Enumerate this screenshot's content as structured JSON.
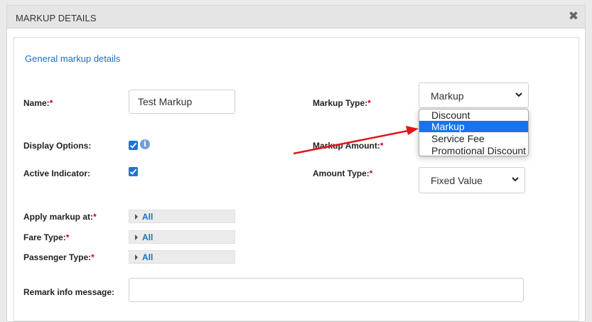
{
  "modal": {
    "title": "MARKUP DETAILS",
    "close_glyph": "✖"
  },
  "section": {
    "title": "General markup details"
  },
  "fields": {
    "name": {
      "label": "Name:",
      "required_mark": "*",
      "value": "Test Markup"
    },
    "display_options": {
      "label": "Display Options:",
      "checked": true,
      "info_icon": "info-icon"
    },
    "active_indicator": {
      "label": "Active Indicator:",
      "checked": true
    },
    "markup_type": {
      "label": "Markup Type:",
      "required_mark": "*",
      "selected": "Markup"
    },
    "markup_amount": {
      "label": "Markup Amount:",
      "required_mark": "*"
    },
    "amount_type": {
      "label": "Amount Type:",
      "required_mark": "*",
      "selected": "Fixed Value"
    },
    "apply_markup_at": {
      "label": "Apply markup at:",
      "required_mark": "*",
      "value": "All"
    },
    "fare_type": {
      "label": "Fare Type:",
      "required_mark": "*",
      "value": "All"
    },
    "passenger_type": {
      "label": "Passenger Type:",
      "required_mark": "*",
      "value": "All"
    },
    "remark_info_message": {
      "label": "Remark info message:",
      "value": ""
    }
  },
  "markup_type_dropdown": {
    "options": [
      "Discount",
      "Markup",
      "Service Fee",
      "Promotional Discount"
    ],
    "highlighted": "Markup"
  },
  "colors": {
    "accent": "#1d6fc4",
    "required": "#d0021b",
    "highlight": "#1a73e8",
    "annotation_arrow": "#e3151a"
  }
}
